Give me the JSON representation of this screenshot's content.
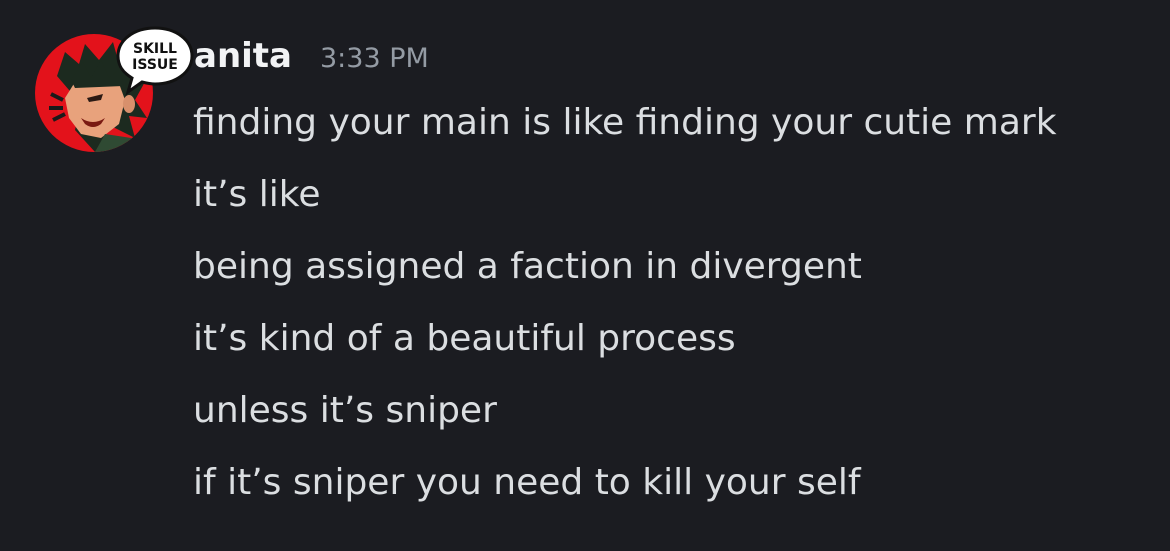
{
  "message_group": {
    "author": {
      "username": "anita",
      "avatar_icon": "anime-character-avatar",
      "avatar_badge_text": [
        "SKILL",
        "ISSUE"
      ],
      "avatar_bg_color": "#e3121b",
      "username_color": "#f2f3f5"
    },
    "timestamp": "3:33 PM",
    "messages": [
      "finding your main is like finding your cutie mark",
      "it’s like",
      "being assigned a faction in divergent",
      "it’s kind of a beautiful process",
      "unless it’s sniper",
      "if it’s sniper you need to kill your self"
    ]
  },
  "theme": {
    "background": "#1b1c21",
    "text": "#dbdee1",
    "muted": "#949ba4"
  }
}
